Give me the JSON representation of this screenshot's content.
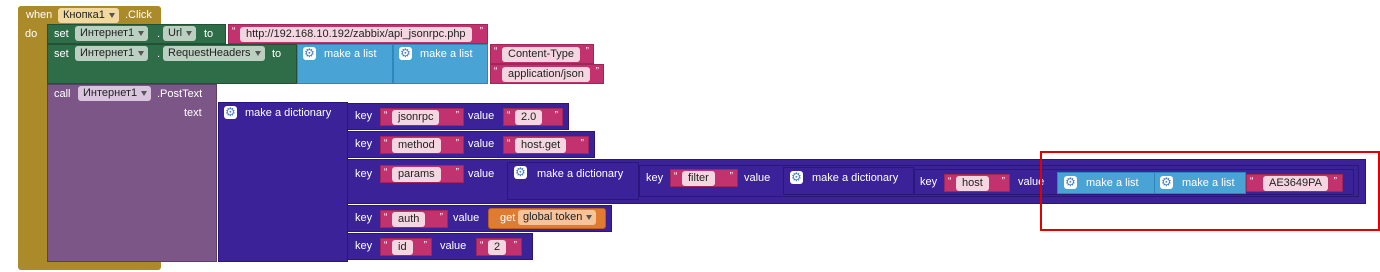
{
  "event": {
    "when": "when",
    "component": "Кнопка1",
    "event": ".Click",
    "do": "do"
  },
  "set1": {
    "set": "set",
    "component": "Интернет1",
    "prop": "Url",
    "to": "to",
    "value": "http://192.168.10.192/zabbix/api_jsonrpc.php"
  },
  "set2": {
    "set": "set",
    "component": "Интернет1",
    "prop": "RequestHeaders",
    "to": "to",
    "make_list": "make a list",
    "item1": "Content-Type",
    "item2": "application/json"
  },
  "call": {
    "call": "call",
    "component": "Интернет1",
    "method": ".PostText",
    "text": "text"
  },
  "dict": {
    "make": "make a dictionary",
    "key": "key",
    "value": "value",
    "pairs": [
      {
        "k": "jsonrpc",
        "v": "2.0"
      },
      {
        "k": "method",
        "v": "host.get"
      },
      {
        "k": "params"
      },
      {
        "k": "auth",
        "get": "get",
        "global": "global token"
      },
      {
        "k": "id",
        "v": "2"
      }
    ],
    "params": {
      "make": "make a dictionary",
      "key": "filter",
      "inner_make": "make a dictionary",
      "inner_key": "host",
      "list": "make a list",
      "value": "AE3649PA"
    }
  },
  "colors": {
    "event": "#ab8a2a",
    "set": "#2f6c48",
    "call": "#7c5687",
    "list": "#4aa3d5",
    "dict": "#3b2299",
    "text": "#c2326f",
    "get": "#e07b32",
    "highlight": "#e00000"
  }
}
